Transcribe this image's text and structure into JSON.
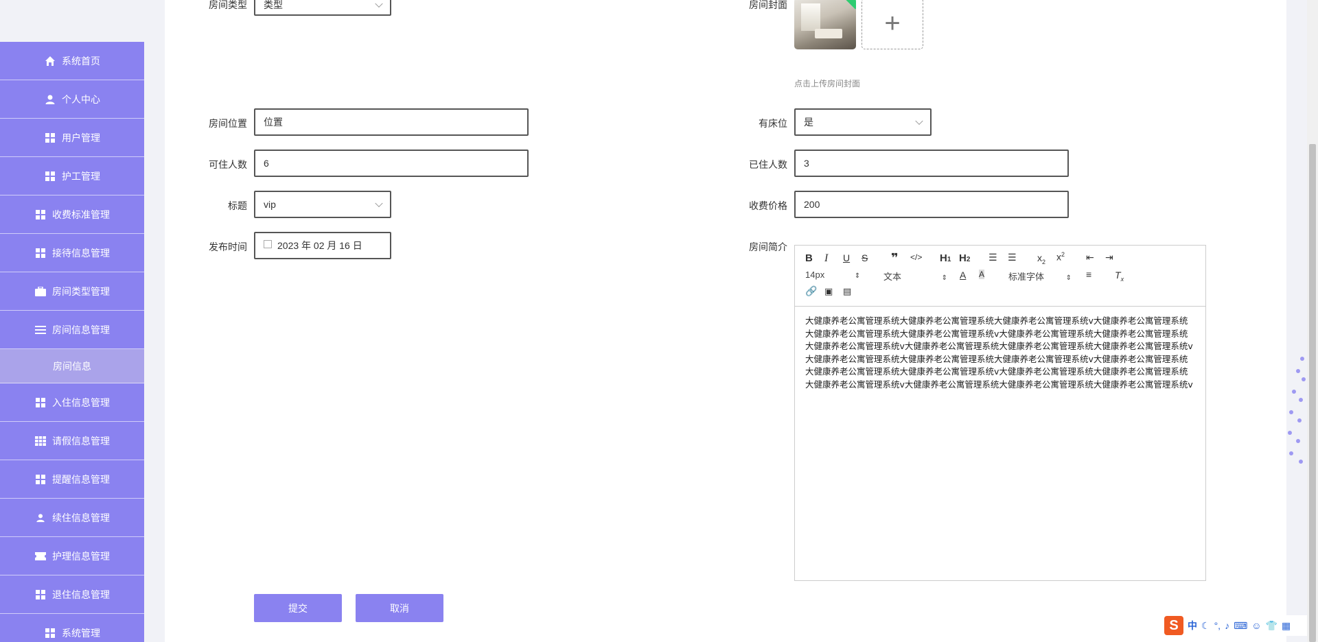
{
  "sidebar": {
    "items": [
      {
        "label": "系统首页",
        "icon": "home-icon"
      },
      {
        "label": "个人中心",
        "icon": "user-icon"
      },
      {
        "label": "用户管理",
        "icon": "grid-icon"
      },
      {
        "label": "护工管理",
        "icon": "grid-icon"
      },
      {
        "label": "收费标准管理",
        "icon": "grid-icon"
      },
      {
        "label": "接待信息管理",
        "icon": "grid-icon"
      },
      {
        "label": "房间类型管理",
        "icon": "briefcase-icon"
      },
      {
        "label": "房间信息管理",
        "icon": "menu-icon"
      }
    ],
    "sub_item": "房间信息",
    "items2": [
      {
        "label": "入住信息管理",
        "icon": "grid-icon"
      },
      {
        "label": "请假信息管理",
        "icon": "table-icon"
      },
      {
        "label": "提醒信息管理",
        "icon": "grid-icon"
      },
      {
        "label": "续住信息管理",
        "icon": "user-icon"
      },
      {
        "label": "护理信息管理",
        "icon": "ticket-icon"
      },
      {
        "label": "退住信息管理",
        "icon": "grid-icon"
      },
      {
        "label": "系统管理",
        "icon": "grid-icon"
      }
    ]
  },
  "form": {
    "room_type_label": "房间类型",
    "room_type_value": "类型",
    "room_cover_label": "房间封面",
    "cover_hint": "点击上传房间封面",
    "location_label": "房间位置",
    "location_value": "位置",
    "has_bed_label": "有床位",
    "has_bed_value": "是",
    "capacity_label": "可住人数",
    "capacity_value": "6",
    "occupied_label": "已住人数",
    "occupied_value": "3",
    "title_label": "标题",
    "title_value": "vip",
    "price_label": "收费价格",
    "price_value": "200",
    "publish_label": "发布时间",
    "publish_value": "2023 年 02 月 16 日",
    "intro_label": "房间简介",
    "intro_text": "大健康养老公寓管理系统大健康养老公寓管理系统大健康养老公寓管理系统v大健康养老公寓管理系统大健康养老公寓管理系统大健康养老公寓管理系统v大健康养老公寓管理系统大健康养老公寓管理系统大健康养老公寓管理系统v大健康养老公寓管理系统大健康养老公寓管理系统大健康养老公寓管理系统v大健康养老公寓管理系统大健康养老公寓管理系统大健康养老公寓管理系统v大健康养老公寓管理系统大健康养老公寓管理系统大健康养老公寓管理系统v大健康养老公寓管理系统大健康养老公寓管理系统大健康养老公寓管理系统v大健康养老公寓管理系统大健康养老公寓管理系统大健康养老公寓管理系统v"
  },
  "editor": {
    "font_size": "14px",
    "block_type": "文本",
    "font_family": "标准字体"
  },
  "buttons": {
    "submit": "提交",
    "cancel": "取消"
  },
  "ime": {
    "mode": "中"
  },
  "colors": {
    "accent": "#8a82f0",
    "sub_active": "#aaa3ea"
  }
}
